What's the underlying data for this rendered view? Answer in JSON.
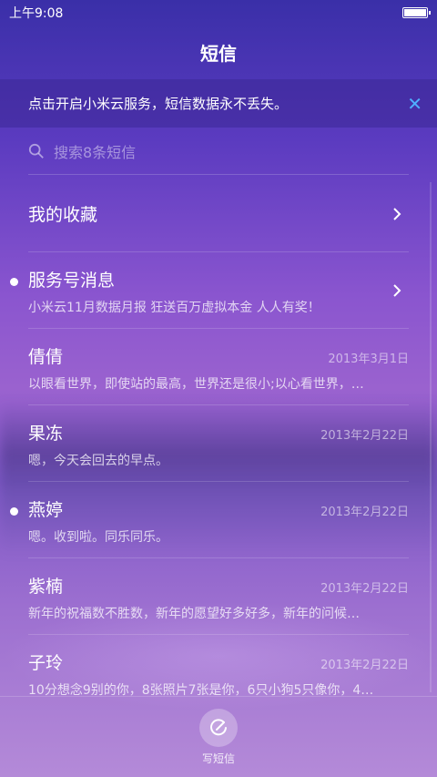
{
  "status_bar": {
    "time": "上午9:08",
    "battery_level": 1.0
  },
  "title": "短信",
  "banner": {
    "text": "点击开启小米云服务，短信数据永不丢失。",
    "close_icon": "close-icon"
  },
  "search": {
    "placeholder": "搜索8条短信"
  },
  "list": [
    {
      "name": "我的收藏",
      "snippet": "",
      "date": "",
      "unread": false,
      "chevron": true
    },
    {
      "name": "服务号消息",
      "snippet": "小米云11月数据月报 狂送百万虚拟本金 人人有奖！",
      "date": "",
      "unread": true,
      "chevron": true
    },
    {
      "name": "倩倩",
      "snippet": "以眼看世界，即使站的最高，世界还是很小;以心看世界，…",
      "date": "2013年3月1日",
      "unread": false,
      "chevron": false
    },
    {
      "name": "果冻",
      "snippet": "嗯，今天会回去的早点。",
      "date": "2013年2月22日",
      "unread": false,
      "chevron": false
    },
    {
      "name": "燕婷",
      "snippet": "嗯。收到啦。同乐同乐。",
      "date": "2013年2月22日",
      "unread": true,
      "chevron": false
    },
    {
      "name": "紫楠",
      "snippet": "新年的祝福数不胜数，新年的愿望好多好多，新年的问候…",
      "date": "2013年2月22日",
      "unread": false,
      "chevron": false
    },
    {
      "name": "子玲",
      "snippet": "10分想念9别的你，8张照片7张是你，6只小狗5只像你，4…",
      "date": "2013年2月22日",
      "unread": false,
      "chevron": false
    }
  ],
  "bottom": {
    "compose_label": "写短信"
  }
}
